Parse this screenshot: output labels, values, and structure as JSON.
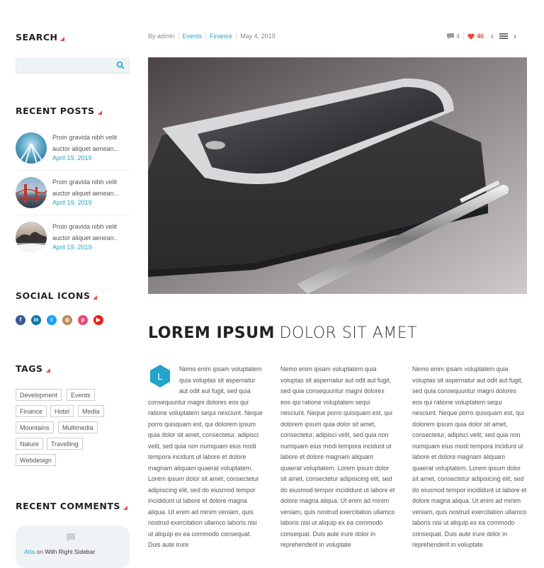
{
  "sidebar": {
    "search": {
      "title": "SEARCH",
      "placeholder": ""
    },
    "recent_posts": {
      "title": "RECENT POSTS",
      "items": [
        {
          "line1": "Proin gravida nibh velit",
          "line2": "auctor aliquet aenean...",
          "date": "April 19, 2019"
        },
        {
          "line1": "Proin gravida nibh velit",
          "line2": "auctor aliquet aenean...",
          "date": "April 19, 2019"
        },
        {
          "line1": "Proin gravida nibh velit",
          "line2": "auctor aliquet aenean..",
          "date": "April 19, 2019"
        }
      ]
    },
    "social": {
      "title": "SOCIAL ICONS",
      "icons": [
        {
          "name": "facebook",
          "glyph": "f",
          "color": "#3b5998"
        },
        {
          "name": "linkedin",
          "glyph": "in",
          "color": "#0e76a8"
        },
        {
          "name": "twitter",
          "glyph": "t",
          "color": "#1da1f2"
        },
        {
          "name": "instagram",
          "glyph": "◎",
          "color": "#b58a52"
        },
        {
          "name": "pinterest",
          "glyph": "p",
          "color": "#e74c7a"
        },
        {
          "name": "youtube",
          "glyph": "▶",
          "color": "#e62117"
        }
      ]
    },
    "tags": {
      "title": "TAGS",
      "items": [
        "Development",
        "Events",
        "Finance",
        "Hotel",
        "Media",
        "Mountains",
        "Multimedia",
        "Nature",
        "Travelling",
        "Webdesign"
      ]
    },
    "recent_comments": {
      "title": "RECENT COMMENTS",
      "author": "Atta",
      "on": "on",
      "post": "With Right Sidebar"
    }
  },
  "article": {
    "meta": {
      "by": "By admin",
      "cat1": "Events",
      "cat2": "Finance",
      "date": "May 4, 2019",
      "comments": "4",
      "likes": "46"
    },
    "headline_bold": "LOREM IPSUM",
    "headline_light": "DOLOR SIT AMET",
    "dropcap_letter": "L",
    "col1": "Nemo enim ipsam voluptatem quia voluptas sit aspernatur aut odit aut fugit, sed quia consequuntur magni dolores eos qui ratione voluptatem sequi nesciunt. Neque porro quisquam est, qui dolorem ipsum quia dolor sit amet, consectetur, adipisci velit, sed quia non numquam eius modi tempora incidunt ut labore et dolore magnam aliquam quaerat voluptatem. Lorem ipsum dolor sit amet, consectetur adipisicing elit, sed do eiusmod tempor incididunt ut labore et dolore magna aliqua. Ut enim ad minim veniam, quis nostrud exercitation ullamco laboris nisi ut aliquip ex ea commodo consequat. Duis aute irure",
    "col2": "Nemo enim ipsam voluptatem quia voluptas sit aspernatur aut odit aut fugit, sed quia consequuntur magni dolores eos qui ratione voluptatem sequi nesciunt. Neque porro quisquam est, qui dolorem ipsum quia dolor sit amet, consectetur, adipisci velit, sed quia non numquam eius modi tempora incidunt ut labore et dolore magnam aliquam quaerat voluptatem. Lorem ipsum dolor sit amet, consectetur adipisicing elit, sed do eiusmod tempor incididunt ut labore et dolore magna aliqua. Ut enim ad minim veniam, quis nostrud exercitation ullamco laboris nisi ut aliquip ex ea commodo consequat. Duis aute irure dolor in reprehenderit in voluptate",
    "col3": "Nemo enim ipsam voluptatem quia voluptas sit aspernatur aut odit aut fugit, sed quia consequuntur magni dolores eos qui ratione voluptatem sequi nesciunt. Neque porro quisquam est, qui dolorem ipsum quia dolor sit amet, consectetur, adipisci velit, sed quia non numquam eius modi tempora incidunt ut labore et dolore magnam aliquam quaerat voluptatem. Lorem ipsum dolor sit amet, consectetur adipisicing elit, sed do eiusmod tempor incididunt ut labore et dolore magna aliqua. Ut enim ad minim veniam, quis nostrud exercitation ullamco laboris nisi ut aliquip ex ea commodo consequat. Duis aute irure dolor in reprehenderit in voluptate"
  },
  "colors": {
    "accent": "#23a3c9",
    "marker": "#e74c3c",
    "heart": "#e74c3c"
  }
}
